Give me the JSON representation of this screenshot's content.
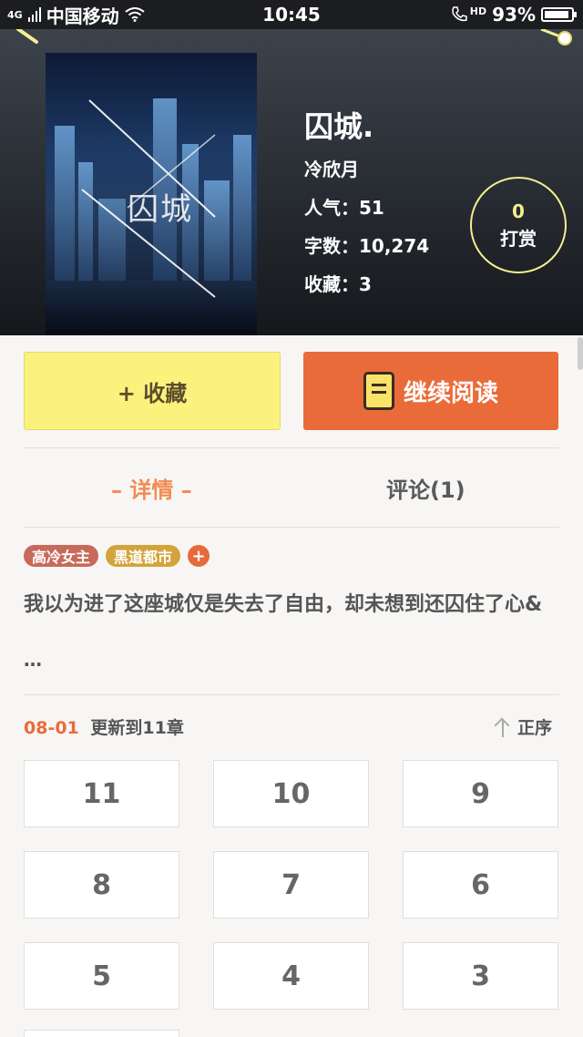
{
  "status_bar": {
    "network": "4G",
    "carrier": "中国移动",
    "time": "10:45",
    "call_label": "HD",
    "battery": "93%",
    "battery_level": 0.93
  },
  "book": {
    "title": "囚城.",
    "cover_title": "囚城",
    "author": "冷欣月",
    "popularity": "人气：51",
    "word_count": "字数：10,274",
    "favorites": "收藏：3"
  },
  "tip": {
    "count": "0",
    "label": "打赏"
  },
  "actions": {
    "favorite_label": "+ 收藏",
    "continue_label": "继续阅读"
  },
  "tabs": {
    "detail": "– 详情 –",
    "comments": "评论(1)"
  },
  "tags": [
    {
      "label": "高冷女主",
      "color": "#c86a5b"
    },
    {
      "label": "黑道都市",
      "color": "#d3a43c"
    }
  ],
  "tag_add": "+",
  "synopsis": "我以为进了这座城仅是失去了自由，却未想到还囚住了心&",
  "synopsis_more": "…",
  "update": {
    "date": "08-01",
    "text": "更新到11章"
  },
  "sort_label": "正序",
  "chapters": [
    "11",
    "10",
    "9",
    "8",
    "7",
    "6",
    "5",
    "4",
    "3"
  ]
}
